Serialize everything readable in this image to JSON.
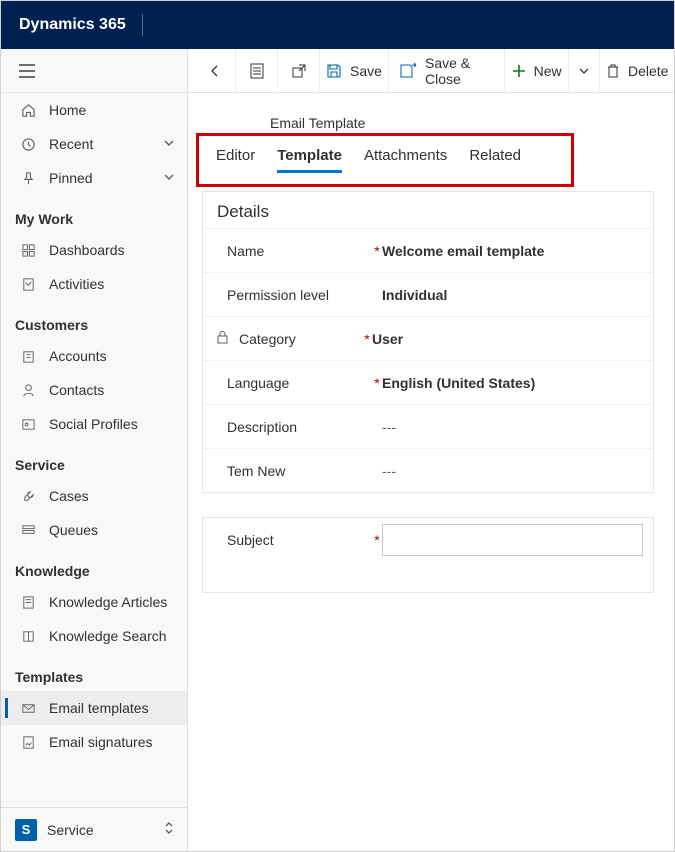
{
  "app": {
    "title": "Dynamics 365"
  },
  "sidebar": {
    "top": [
      {
        "label": "Home",
        "icon": "home"
      },
      {
        "label": "Recent",
        "icon": "clock",
        "chev": true
      },
      {
        "label": "Pinned",
        "icon": "pin",
        "chev": true
      }
    ],
    "groups": [
      {
        "title": "My Work",
        "items": [
          {
            "label": "Dashboards",
            "icon": "dashboard"
          },
          {
            "label": "Activities",
            "icon": "clipboard"
          }
        ]
      },
      {
        "title": "Customers",
        "items": [
          {
            "label": "Accounts",
            "icon": "building"
          },
          {
            "label": "Contacts",
            "icon": "person"
          },
          {
            "label": "Social Profiles",
            "icon": "profile"
          }
        ]
      },
      {
        "title": "Service",
        "items": [
          {
            "label": "Cases",
            "icon": "wrench"
          },
          {
            "label": "Queues",
            "icon": "queue"
          }
        ]
      },
      {
        "title": "Knowledge",
        "items": [
          {
            "label": "Knowledge Articles",
            "icon": "kb"
          },
          {
            "label": "Knowledge Search",
            "icon": "book"
          }
        ]
      },
      {
        "title": "Templates",
        "items": [
          {
            "label": "Email templates",
            "icon": "email-template",
            "selected": true
          },
          {
            "label": "Email signatures",
            "icon": "signature"
          }
        ]
      }
    ],
    "area": {
      "badge": "S",
      "label": "Service"
    }
  },
  "commands": {
    "save": "Save",
    "save_close": "Save & Close",
    "new": "New",
    "delete": "Delete"
  },
  "record": {
    "entity": "Email Template",
    "tabs": [
      "Editor",
      "Template",
      "Attachments",
      "Related"
    ],
    "active_tab": 1,
    "details_title": "Details",
    "fields": [
      {
        "label": "Name",
        "required": true,
        "value": "Welcome email template",
        "bold": true
      },
      {
        "label": "Permission level",
        "required": false,
        "value": "Individual",
        "bold": true
      },
      {
        "label": "Category",
        "required": true,
        "value": "User",
        "bold": true,
        "locked": true
      },
      {
        "label": "Language",
        "required": true,
        "value": "English (United States)",
        "bold": true
      },
      {
        "label": "Description",
        "required": false,
        "value": "---",
        "bold": false
      },
      {
        "label": "Tem New",
        "required": false,
        "value": "---",
        "bold": false
      }
    ],
    "subject": {
      "label": "Subject",
      "required": true,
      "value": ""
    }
  }
}
